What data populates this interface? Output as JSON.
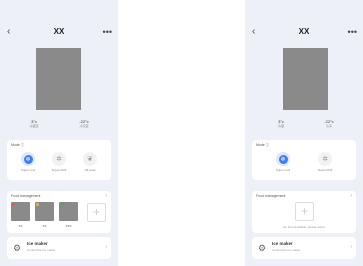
{
  "screens": [
    {
      "header": {
        "back": "‹",
        "title": "XX",
        "more": "•••"
      },
      "temps": [
        {
          "value": "3°c",
          "label": "冷藏室"
        },
        {
          "value": "-22°c",
          "label": "冷冻室"
        }
      ],
      "mode": {
        "title": "Mode",
        "options": [
          {
            "label": "Super cool",
            "icon": "snowflake-icon",
            "active": true
          },
          {
            "label": "Super FRZ",
            "icon": "freeze-icon",
            "active": false
          },
          {
            "label": "Off peak",
            "icon": "leaf-icon",
            "active": false
          }
        ]
      },
      "food": {
        "title": "Food management",
        "items": [
          {
            "label": "XX",
            "dot": "#e05a4f"
          },
          {
            "label": "XX",
            "dot": "#f0b23a"
          },
          {
            "label": "XXX",
            "dot": "#4caf50"
          }
        ]
      },
      "ice": {
        "title": "Ice maker",
        "sub": "Control the ice maker"
      }
    },
    {
      "header": {
        "back": "‹",
        "title": "XX",
        "more": "•••"
      },
      "temps": [
        {
          "value": "3°c",
          "label": "冷藏"
        },
        {
          "value": "-22°c",
          "label": "冷冻"
        }
      ],
      "mode": {
        "title": "Mode",
        "options": [
          {
            "label": "Super cool",
            "icon": "snowflake-icon",
            "active": true
          },
          {
            "label": "Super FRZ",
            "icon": "freeze-icon",
            "active": false
          }
        ]
      },
      "food": {
        "title": "Food management",
        "empty_text": "No food available, please add it"
      },
      "ice": {
        "title": "Ice maker",
        "sub": "Control the ice maker"
      }
    }
  ],
  "colors": {
    "accent": "#3d7ef6",
    "placeholder": "#8a8a8a",
    "background": "#eef0f7"
  }
}
